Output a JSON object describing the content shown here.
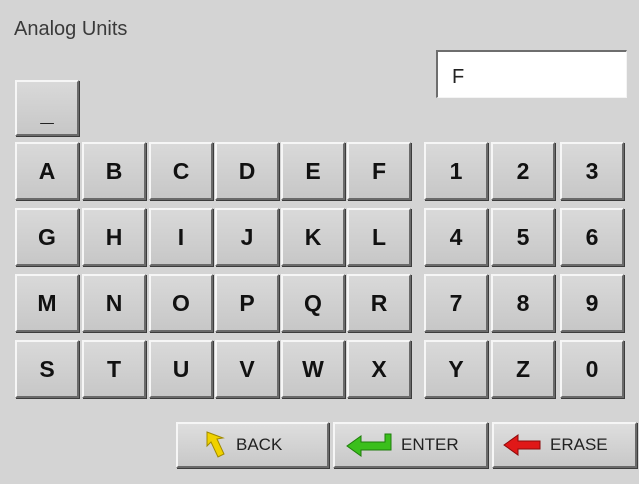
{
  "screen": {
    "title": "Analog Units"
  },
  "entry": {
    "value": "F"
  },
  "underscore_key": "_",
  "rows": [
    [
      "A",
      "B",
      "C",
      "D",
      "E",
      "F",
      "1",
      "2",
      "3"
    ],
    [
      "G",
      "H",
      "I",
      "J",
      "K",
      "L",
      "4",
      "5",
      "6"
    ],
    [
      "M",
      "N",
      "O",
      "P",
      "Q",
      "R",
      "7",
      "8",
      "9"
    ],
    [
      "S",
      "T",
      "U",
      "V",
      "W",
      "X",
      "Y",
      "Z",
      "0"
    ]
  ],
  "buttons": {
    "back": {
      "label": "BACK",
      "icon": "yellow-arrow-icon",
      "color": "#f0d200"
    },
    "enter": {
      "label": "ENTER",
      "icon": "green-enter-arrow-icon",
      "color": "#3bbf1c"
    },
    "erase": {
      "label": "ERASE",
      "icon": "red-left-arrow-icon",
      "color": "#e01818"
    }
  }
}
